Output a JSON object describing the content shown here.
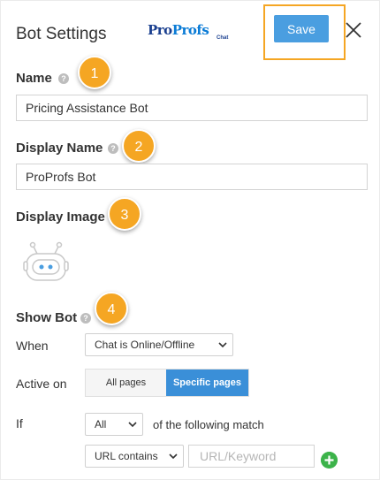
{
  "header": {
    "title": "Bot Settings",
    "logo_main": "ProProfs",
    "logo_main_a": "Pro",
    "logo_main_b": "Profs",
    "logo_sub": "Chat",
    "save_label": "Save"
  },
  "name": {
    "label": "Name",
    "value": "Pricing Assistance Bot",
    "badge": "1"
  },
  "display_name": {
    "label": "Display Name",
    "value": "ProProfs Bot",
    "badge": "2"
  },
  "display_image": {
    "label": "Display Image",
    "badge": "3",
    "icon": "bot-avatar-icon"
  },
  "show_bot": {
    "label": "Show Bot",
    "badge": "4",
    "when_label": "When",
    "when_value": "Chat is Online/Offline",
    "active_label": "Active on",
    "active_options": [
      "All pages",
      "Specific pages"
    ],
    "active_selected": "Specific pages",
    "if_label": "If",
    "if_value": "All",
    "if_suffix": "of the following match",
    "rule_type": "URL contains",
    "rule_placeholder": "URL/Keyword"
  },
  "colors": {
    "accent": "#4a9ee0",
    "highlight": "#f5a623",
    "selected_toggle": "#3a8fd8",
    "add": "#3cb34a"
  }
}
